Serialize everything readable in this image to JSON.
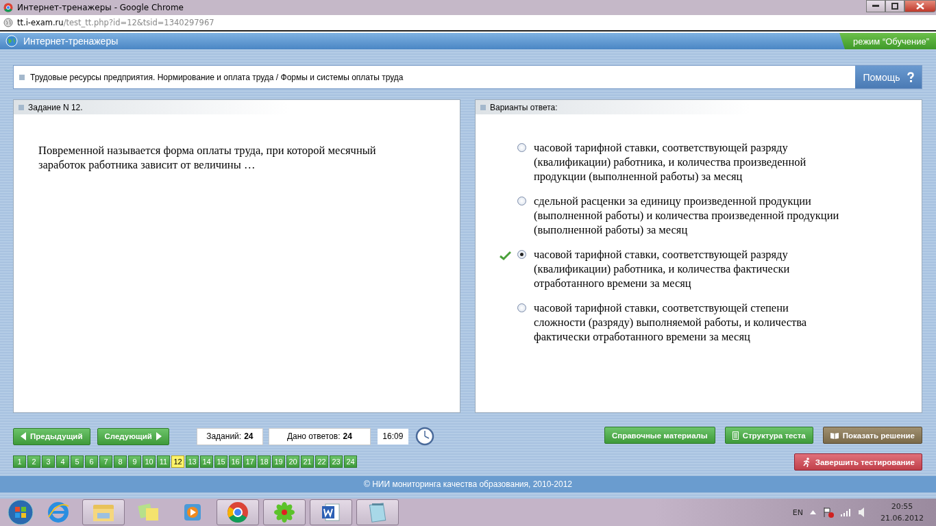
{
  "window": {
    "title": "Интернет-тренажеры - Google Chrome"
  },
  "address_bar": {
    "host": "tt.i-exam.ru",
    "path": "/test_tt.php?id=12&tsid=1340297967"
  },
  "app_header": {
    "title": "Интернет-тренажеры",
    "mode": "режим “Обучение”"
  },
  "topic": {
    "text": "Трудовые ресурсы предприятия. Нормирование и оплата труда / Формы и системы оплаты труда",
    "help": "Помощь"
  },
  "task_panel": {
    "heading": "Задание N 12.",
    "question": "Повременной называется форма оплаты труда, при которой месячный заработок работника зависит от величины …"
  },
  "answers_panel": {
    "heading": "Варианты ответа:",
    "options": [
      {
        "text": "часовой тарифной ставки, соответствующей разряду (квалификации) работника, и количества произведенной продукции (выполненной работы) за месяц",
        "selected": false,
        "correct": false
      },
      {
        "text": "сдельной расценки за единицу произведенной продукции (выполненной работы) и количества произведенной продукции (выполненной работы) за месяц",
        "selected": false,
        "correct": false
      },
      {
        "text": "часовой тарифной ставки, соответствующей разряду (квалификации) работника, и количества фактически отработанного времени за месяц",
        "selected": true,
        "correct": true
      },
      {
        "text": "часовой тарифной ставки, соответствующей степени сложности (разряду) выполняемой работы, и количества фактически отработанного времени за месяц",
        "selected": false,
        "correct": false
      }
    ]
  },
  "navigation": {
    "previous": "Предыдущий",
    "next": "Следующий",
    "tasks_label": "Заданий:",
    "tasks_value": "24",
    "answered_label": "Дано ответов:",
    "answered_value": "24",
    "timer": "16:09"
  },
  "task_numbers": [
    {
      "label": "1",
      "selected": false
    },
    {
      "label": "2",
      "selected": false
    },
    {
      "label": "3",
      "selected": false
    },
    {
      "label": "4",
      "selected": false
    },
    {
      "label": "5",
      "selected": false
    },
    {
      "label": "6",
      "selected": false
    },
    {
      "label": "7",
      "selected": false
    },
    {
      "label": "8",
      "selected": false
    },
    {
      "label": "9",
      "selected": false
    },
    {
      "label": "10",
      "selected": false
    },
    {
      "label": "11",
      "selected": false
    },
    {
      "label": "12",
      "selected": true
    },
    {
      "label": "13",
      "selected": false
    },
    {
      "label": "14",
      "selected": false
    },
    {
      "label": "15",
      "selected": false
    },
    {
      "label": "16",
      "selected": false
    },
    {
      "label": "17",
      "selected": false
    },
    {
      "label": "18",
      "selected": false
    },
    {
      "label": "19",
      "selected": false
    },
    {
      "label": "20",
      "selected": false
    },
    {
      "label": "21",
      "selected": false
    },
    {
      "label": "22",
      "selected": false
    },
    {
      "label": "23",
      "selected": false
    },
    {
      "label": "24",
      "selected": false
    }
  ],
  "action_buttons": [
    {
      "label": "Справочные материалы",
      "kind": "reference"
    },
    {
      "label": "Структура теста",
      "kind": "structure"
    },
    {
      "label": "Показать решение",
      "kind": "solution"
    }
  ],
  "finish_button": {
    "label": "Завершить тестирование"
  },
  "footer": {
    "text": "© НИИ мониторинга качества образования, 2010-2012"
  },
  "taskbar": {
    "apps": [
      {
        "kind": "ie",
        "running": false
      },
      {
        "kind": "explorer",
        "running": true
      },
      {
        "kind": "notes",
        "running": false
      },
      {
        "kind": "media",
        "running": false
      },
      {
        "kind": "chrome",
        "running": true
      },
      {
        "kind": "icq",
        "running": true
      },
      {
        "kind": "word",
        "running": true
      },
      {
        "kind": "notepad",
        "running": true
      }
    ],
    "language": "EN",
    "time": "20:55",
    "date": "21.06.2012"
  }
}
